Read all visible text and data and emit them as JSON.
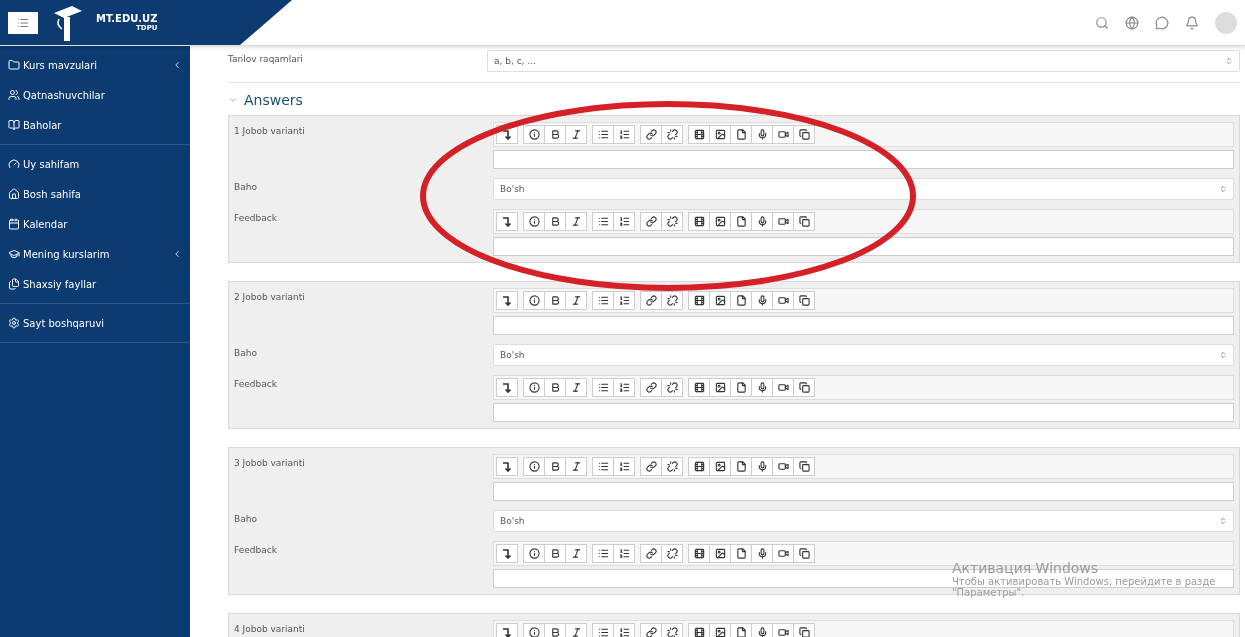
{
  "header": {
    "site_name": "MT.EDU.UZ",
    "site_subtitle": "TDPU"
  },
  "sidebar": {
    "groups": [
      [
        {
          "label": "Kurs mavzulari",
          "expandable": true
        },
        {
          "label": "Qatnashuvchilar",
          "expandable": false
        },
        {
          "label": "Baholar",
          "expandable": false
        }
      ],
      [
        {
          "label": "Uy sahifam",
          "expandable": false
        },
        {
          "label": "Bosh sahifa",
          "expandable": false
        },
        {
          "label": "Kalendar",
          "expandable": false
        },
        {
          "label": "Mening kurslarim",
          "expandable": true
        },
        {
          "label": "Shaxsiy fayllar",
          "expandable": false
        }
      ],
      [
        {
          "label": "Sayt boshqaruvi",
          "expandable": false
        }
      ]
    ]
  },
  "numbering": {
    "label": "Tanlov raqamlari",
    "value": "a, b, c, ..."
  },
  "section": {
    "title": "Answers",
    "expanded": true
  },
  "answers": [
    {
      "label": "1 Jobob varianti",
      "grade_label": "Baho",
      "grade": "Bo'sh",
      "feedback_label": "Feedback"
    },
    {
      "label": "2 Jobob varianti",
      "grade_label": "Baho",
      "grade": "Bo'sh",
      "feedback_label": "Feedback"
    },
    {
      "label": "3 Jobob varianti",
      "grade_label": "Baho",
      "grade": "Bo'sh",
      "feedback_label": "Feedback"
    },
    {
      "label": "4 Jobob varianti"
    }
  ],
  "annotation": {
    "kind": "ellipse"
  },
  "os_notice": {
    "title": "Активация Windows",
    "lines": [
      "Чтобы активировать Windows, перейдите в разде",
      "\"Параметры\"."
    ]
  }
}
